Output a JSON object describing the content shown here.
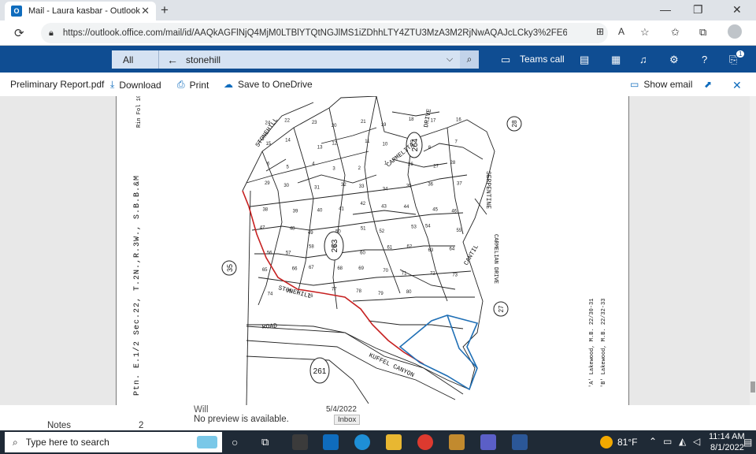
{
  "browser": {
    "tab_title": "Mail - Laura kasbar - Outlook",
    "tab_close": "✕",
    "new_tab": "+",
    "url": "https://outlook.office.com/mail/id/AAQkAGFlNjQ4MjM0LTBlYTQtNGJlMS1iZDhhLTY4ZTU3MzA3M2RjNwAQAJcLCky3%2FE6okfaaWB..."
  },
  "outlook": {
    "search_scope": "All",
    "search_query": "stonehill",
    "teams_call": "Teams call",
    "notification_count": "1"
  },
  "attachment_toolbar": {
    "file_name": "Preliminary Report.pdf",
    "download": "Download",
    "print": "Print",
    "save": "Save to OneDrive",
    "show_email": "Show email"
  },
  "map": {
    "title_left": "Ptn. E.1/2 Sec.22, T.2N.,R.3W., S.B.B.&M",
    "street_stonehill": "STONEHILL",
    "street_stonehill_lower": "STONEHILL",
    "street_drive": "DRIVE",
    "street_road": "ROAD",
    "street_kuffel": "KUFFEL CANYON",
    "street_carmelita": "CARMELITA",
    "street_serpentine": "SERPENTINE",
    "street_carmelian": "CARMELIAN DRIVE",
    "street_cantil": "CANTIL",
    "block_263": "263",
    "block_264": "264",
    "block_261": "261",
    "ref_35": "35",
    "ref_28": "28",
    "ref_27": "27",
    "note_a": "'A' Lakewood, M.B. 22/30-31",
    "note_b": "'B' Lakewood, M.B. 22/32-33",
    "corner_top": "Rin Fol 105",
    "lot_numbers": [
      "24",
      "22",
      "23",
      "20",
      "21",
      "19",
      "18",
      "17",
      "16",
      "15",
      "14",
      "13",
      "12",
      "11",
      "10",
      "9",
      "8",
      "7",
      "6",
      "5",
      "4",
      "3",
      "2",
      "1",
      "26",
      "27",
      "28",
      "29",
      "30",
      "31",
      "32",
      "33",
      "34",
      "35",
      "36",
      "37",
      "38",
      "39",
      "40",
      "41",
      "42",
      "43",
      "44",
      "45",
      "46",
      "47",
      "48",
      "49",
      "50",
      "51",
      "52",
      "53",
      "54",
      "55",
      "56",
      "57",
      "58",
      "59",
      "60",
      "61",
      "62",
      "63",
      "64",
      "65",
      "66",
      "67",
      "68",
      "69",
      "70",
      "71",
      "72",
      "73",
      "74",
      "75",
      "76",
      "77",
      "78",
      "79",
      "80"
    ]
  },
  "mail_peek": {
    "folder": "Notes",
    "folder_count": "2",
    "sender": "Will",
    "preview": "No preview is available.",
    "date": "5/4/2022",
    "tag": "Inbox"
  },
  "taskbar": {
    "search_placeholder": "Type here to search",
    "temperature": "81°F",
    "time": "11:14 AM",
    "date": "8/1/2022"
  }
}
